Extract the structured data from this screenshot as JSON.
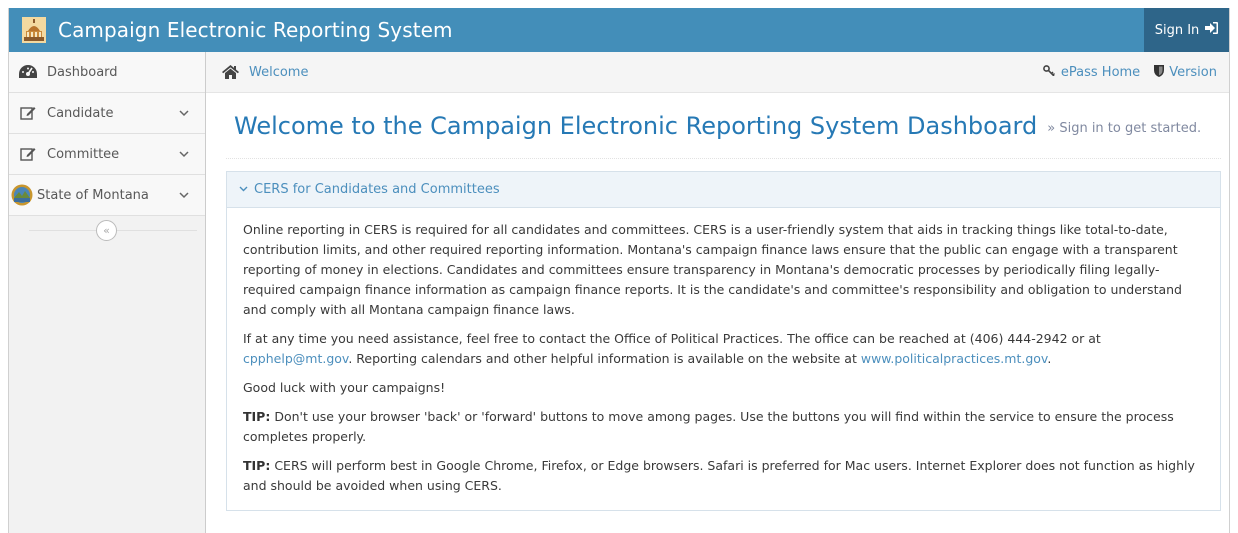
{
  "app": {
    "title": "Campaign Electronic Reporting System",
    "sign_in_label": "Sign In"
  },
  "sidebar": {
    "items": [
      {
        "label": "Dashboard",
        "icon": "tachometer-icon"
      },
      {
        "label": "Candidate",
        "icon": "edit-icon"
      },
      {
        "label": "Committee",
        "icon": "edit-icon"
      },
      {
        "label": "State of Montana",
        "icon": "state-seal-icon"
      }
    ],
    "collapse_label": "«"
  },
  "breadcrumbs": {
    "home_icon": "home-icon",
    "current": "Welcome",
    "epass_label": "ePass Home",
    "version_label": "Version"
  },
  "page": {
    "title": "Welcome to the Campaign Electronic Reporting System Dashboard",
    "subtitle": "» Sign in to get started."
  },
  "panel": {
    "title": "CERS for Candidates and Committees",
    "para1": "Online reporting in CERS is required for all candidates and committees. CERS is a user-friendly system that aids in tracking things like total-to-date, contribution limits, and other required reporting information. Montana's campaign finance laws ensure that the public can engage with a transparent reporting of money in elections. Candidates and committees ensure transparency in Montana's democratic processes by periodically filing legally-required campaign finance information as campaign finance reports. It is the candidate's and committee's responsibility and obligation to understand and comply with all Montana campaign finance laws.",
    "para2_before": "If at any time you need assistance, feel free to contact the Office of Political Practices. The office can be reached at (406) 444-2942 or at ",
    "para2_email": "cpphelp@mt.gov",
    "para2_mid": ". Reporting calendars and other helpful information is available on the website at ",
    "para2_site": "www.politicalpractices.mt.gov",
    "para2_end": ".",
    "para3": "Good luck with your campaigns!",
    "tip_label": "TIP:",
    "tip1": " Don't use your browser 'back' or 'forward' buttons to move among pages. Use the buttons you will find within the service to ensure the process completes properly.",
    "tip2": " CERS will perform best in Google Chrome, Firefox, or Edge browsers. Safari is preferred for Mac users. Internet Explorer does not function as highly and should be avoided when using CERS."
  },
  "colors": {
    "navbar": "#438eb9",
    "signin": "#2e6589",
    "link": "#4c8fbd",
    "title": "#2679b5"
  }
}
